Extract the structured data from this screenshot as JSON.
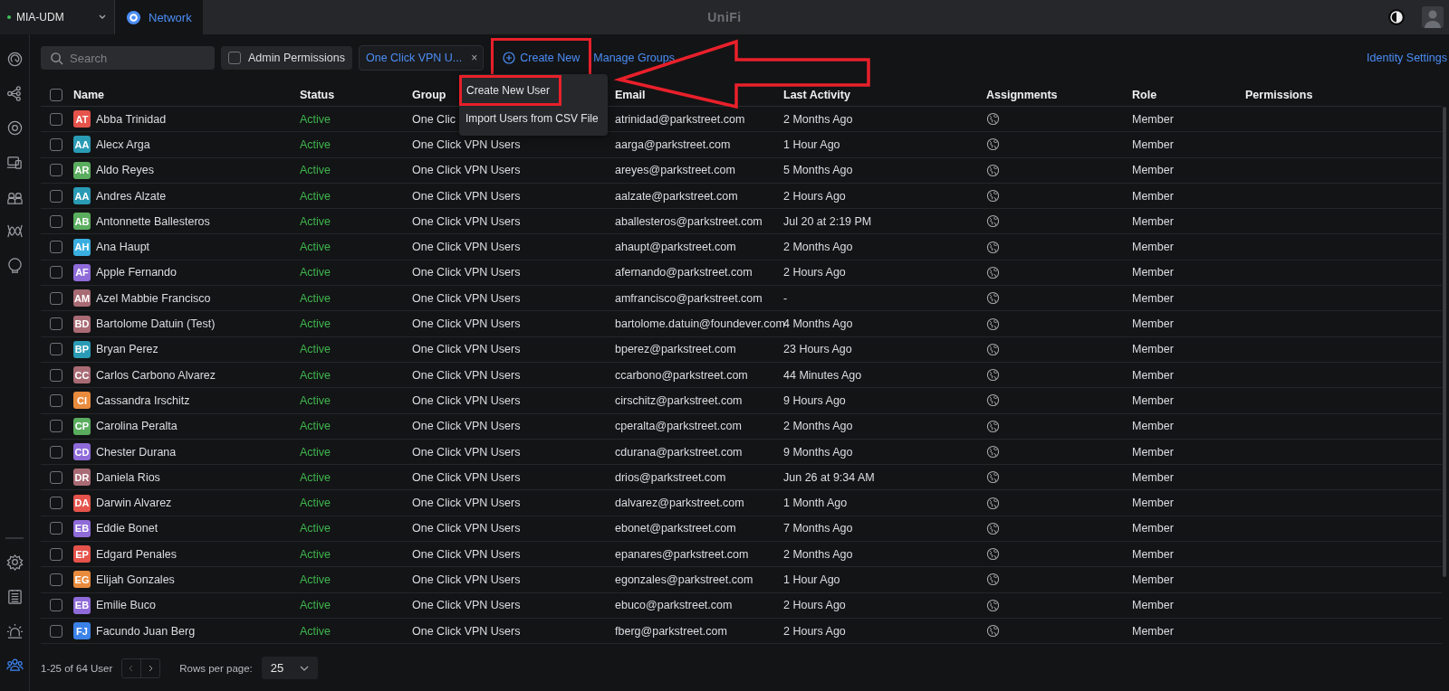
{
  "topbar": {
    "site": "MIA-UDM",
    "site_online": true,
    "app_tab": {
      "label": "Network",
      "selected": true
    },
    "logo": "UniFi"
  },
  "sidebar": {
    "items": [
      {
        "kind": "radar",
        "selected": false
      },
      {
        "kind": "topology",
        "selected": false
      },
      {
        "kind": "target",
        "selected": false
      },
      {
        "kind": "devices",
        "selected": false
      },
      {
        "kind": "clients",
        "selected": false
      },
      {
        "kind": "wave",
        "selected": false
      },
      {
        "kind": "bulb",
        "selected": false
      }
    ],
    "bottom_items": [
      {
        "kind": "gear",
        "selected": false
      },
      {
        "kind": "list",
        "selected": false
      },
      {
        "kind": "alarm",
        "selected": false
      },
      {
        "kind": "users",
        "selected": true
      }
    ]
  },
  "toolbar": {
    "search": {
      "placeholder": "Search"
    },
    "admin_permissions": {
      "label": "Admin Permissions",
      "checked": false
    },
    "filter_chip": {
      "label": "One Click VPN U...",
      "close": "×"
    },
    "create_new": {
      "label": "Create New",
      "highlighted": true
    },
    "manage_groups": "Manage Groups",
    "identity_settings": "Identity Settings"
  },
  "create_menu": {
    "items": [
      {
        "label": "Create New User",
        "highlighted": true
      },
      {
        "label": "Import Users from CSV File",
        "highlighted": false
      }
    ]
  },
  "annotation_arrow": true,
  "table": {
    "select_all": {
      "checked": false
    },
    "columns": [
      "Name",
      "Status",
      "Group",
      "Email",
      "Last Activity",
      "Assignments",
      "Role",
      "Permissions"
    ],
    "rows": [
      {
        "checked": false,
        "initials": "AT",
        "color": "#e5534b",
        "name": "Abba Trinidad",
        "status": "Active",
        "group": "One Clic",
        "email": "atrinidad@parkstreet.com",
        "last_activity": "2 Months Ago",
        "role": "Member"
      },
      {
        "checked": false,
        "initials": "AA",
        "color": "#2a9bb5",
        "name": "Alecx Arga",
        "status": "Active",
        "group": "One Click VPN Users",
        "email": "aarga@parkstreet.com",
        "last_activity": "1 Hour Ago",
        "role": "Member"
      },
      {
        "checked": false,
        "initials": "AR",
        "color": "#5aad5e",
        "name": "Aldo Reyes",
        "status": "Active",
        "group": "One Click VPN Users",
        "email": "areyes@parkstreet.com",
        "last_activity": "5 Months Ago",
        "role": "Member"
      },
      {
        "checked": false,
        "initials": "AA",
        "color": "#2a9bb5",
        "name": "Andres Alzate",
        "status": "Active",
        "group": "One Click VPN Users",
        "email": "aalzate@parkstreet.com",
        "last_activity": "2 Hours Ago",
        "role": "Member"
      },
      {
        "checked": false,
        "initials": "AB",
        "color": "#5aad5e",
        "name": "Antonnette Ballesteros",
        "status": "Active",
        "group": "One Click VPN Users",
        "email": "aballesteros@parkstreet.com",
        "last_activity": "Jul 20 at 2:19 PM",
        "role": "Member"
      },
      {
        "checked": false,
        "initials": "AH",
        "color": "#3aaee0",
        "name": "Ana Haupt",
        "status": "Active",
        "group": "One Click VPN Users",
        "email": "ahaupt@parkstreet.com",
        "last_activity": "2 Months Ago",
        "role": "Member"
      },
      {
        "checked": false,
        "initials": "AF",
        "color": "#8e6bd8",
        "name": "Apple Fernando",
        "status": "Active",
        "group": "One Click VPN Users",
        "email": "afernando@parkstreet.com",
        "last_activity": "2 Hours Ago",
        "role": "Member"
      },
      {
        "checked": false,
        "initials": "AM",
        "color": "#a86b74",
        "name": "Azel Mabbie Francisco",
        "status": "Active",
        "group": "One Click VPN Users",
        "email": "amfrancisco@parkstreet.com",
        "last_activity": "-",
        "role": "Member"
      },
      {
        "checked": false,
        "initials": "BD",
        "color": "#a86b74",
        "name": "Bartolome Datuin (Test)",
        "status": "Active",
        "group": "One Click VPN Users",
        "email": "bartolome.datuin@foundever.com",
        "last_activity": "4 Months Ago",
        "role": "Member"
      },
      {
        "checked": false,
        "initials": "BP",
        "color": "#2a9bb5",
        "name": "Bryan Perez",
        "status": "Active",
        "group": "One Click VPN Users",
        "email": "bperez@parkstreet.com",
        "last_activity": "23 Hours Ago",
        "role": "Member"
      },
      {
        "checked": false,
        "initials": "CC",
        "color": "#a86b74",
        "name": "Carlos Carbono Alvarez",
        "status": "Active",
        "group": "One Click VPN Users",
        "email": "ccarbono@parkstreet.com",
        "last_activity": "44 Minutes Ago",
        "role": "Member"
      },
      {
        "checked": false,
        "initials": "CI",
        "color": "#e98b3d",
        "name": "Cassandra Irschitz",
        "status": "Active",
        "group": "One Click VPN Users",
        "email": "cirschitz@parkstreet.com",
        "last_activity": "9 Hours Ago",
        "role": "Member"
      },
      {
        "checked": false,
        "initials": "CP",
        "color": "#5aad5e",
        "name": "Carolina Peralta",
        "status": "Active",
        "group": "One Click VPN Users",
        "email": "cperalta@parkstreet.com",
        "last_activity": "2 Months Ago",
        "role": "Member"
      },
      {
        "checked": false,
        "initials": "CD",
        "color": "#8e6bd8",
        "name": "Chester Durana",
        "status": "Active",
        "group": "One Click VPN Users",
        "email": "cdurana@parkstreet.com",
        "last_activity": "9 Months Ago",
        "role": "Member"
      },
      {
        "checked": false,
        "initials": "DR",
        "color": "#a86b74",
        "name": "Daniela Rios",
        "status": "Active",
        "group": "One Click VPN Users",
        "email": "drios@parkstreet.com",
        "last_activity": "Jun 26 at 9:34 AM",
        "role": "Member"
      },
      {
        "checked": false,
        "initials": "DA",
        "color": "#e5534b",
        "name": "Darwin Alvarez",
        "status": "Active",
        "group": "One Click VPN Users",
        "email": "dalvarez@parkstreet.com",
        "last_activity": "1 Month Ago",
        "role": "Member"
      },
      {
        "checked": false,
        "initials": "EB",
        "color": "#8e6bd8",
        "name": "Eddie Bonet",
        "status": "Active",
        "group": "One Click VPN Users",
        "email": "ebonet@parkstreet.com",
        "last_activity": "7 Months Ago",
        "role": "Member"
      },
      {
        "checked": false,
        "initials": "EP",
        "color": "#e5534b",
        "name": "Edgard Penales",
        "status": "Active",
        "group": "One Click VPN Users",
        "email": "epanares@parkstreet.com",
        "last_activity": "2 Months Ago",
        "role": "Member"
      },
      {
        "checked": false,
        "initials": "EG",
        "color": "#e98b3d",
        "name": "Elijah Gonzales",
        "status": "Active",
        "group": "One Click VPN Users",
        "email": "egonzales@parkstreet.com",
        "last_activity": "1 Hour Ago",
        "role": "Member"
      },
      {
        "checked": false,
        "initials": "EB",
        "color": "#8e6bd8",
        "name": "Emilie Buco",
        "status": "Active",
        "group": "One Click VPN Users",
        "email": "ebuco@parkstreet.com",
        "last_activity": "2 Hours Ago",
        "role": "Member"
      },
      {
        "checked": false,
        "initials": "FJ",
        "color": "#3b82e8",
        "name": "Facundo Juan Berg",
        "status": "Active",
        "group": "One Click VPN Users",
        "email": "fberg@parkstreet.com",
        "last_activity": "2 Hours Ago",
        "role": "Member"
      }
    ]
  },
  "footer": {
    "range": "1-25 of 64 User",
    "rows_per_page_label": "Rows per page:",
    "rows_per_page": "25"
  }
}
